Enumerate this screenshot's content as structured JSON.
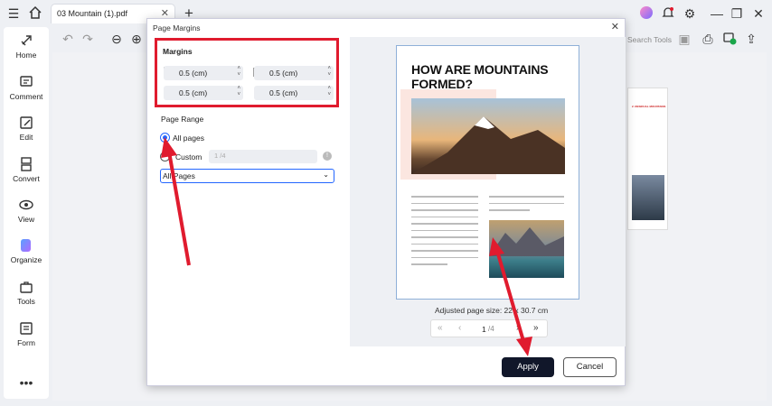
{
  "app": {
    "tab_title": "03 Mountain (1).pdf",
    "search_label": "Search Tools"
  },
  "sidebar": {
    "items": [
      {
        "label": "Home",
        "icon": "rocket-icon"
      },
      {
        "label": "Comment",
        "icon": "comment-icon"
      },
      {
        "label": "Edit",
        "icon": "edit-icon"
      },
      {
        "label": "Convert",
        "icon": "convert-icon"
      },
      {
        "label": "View",
        "icon": "eye-icon"
      },
      {
        "label": "Organize",
        "icon": "organize-icon"
      },
      {
        "label": "Tools",
        "icon": "toolbox-icon"
      },
      {
        "label": "Form",
        "icon": "form-icon"
      }
    ]
  },
  "dialog": {
    "title": "Page Margins",
    "margins_label": "Margins",
    "margin_top": "0.5 (cm)",
    "margin_left": "0.5 (cm)",
    "margin_bottom": "0.5 (cm)",
    "margin_right": "0.5 (cm)",
    "page_range_label": "Page Range",
    "all_pages_label": "All pages",
    "custom_label": "Custom",
    "custom_placeholder": "1 /4",
    "subset_value": "All Pages",
    "page_size_text": "Adjusted page size: 22 x 30.7 cm",
    "page_current": "1",
    "page_total": "/4",
    "apply_label": "Apply",
    "cancel_label": "Cancel"
  },
  "preview": {
    "heading": "HOW ARE MOUNTAINS FORMED?",
    "thumb_heading": "2. RESIDUAL MOUNTAINS"
  },
  "colors": {
    "accent": "#2366ff",
    "highlight": "#e01b2e",
    "apply_bg": "#11172a"
  }
}
